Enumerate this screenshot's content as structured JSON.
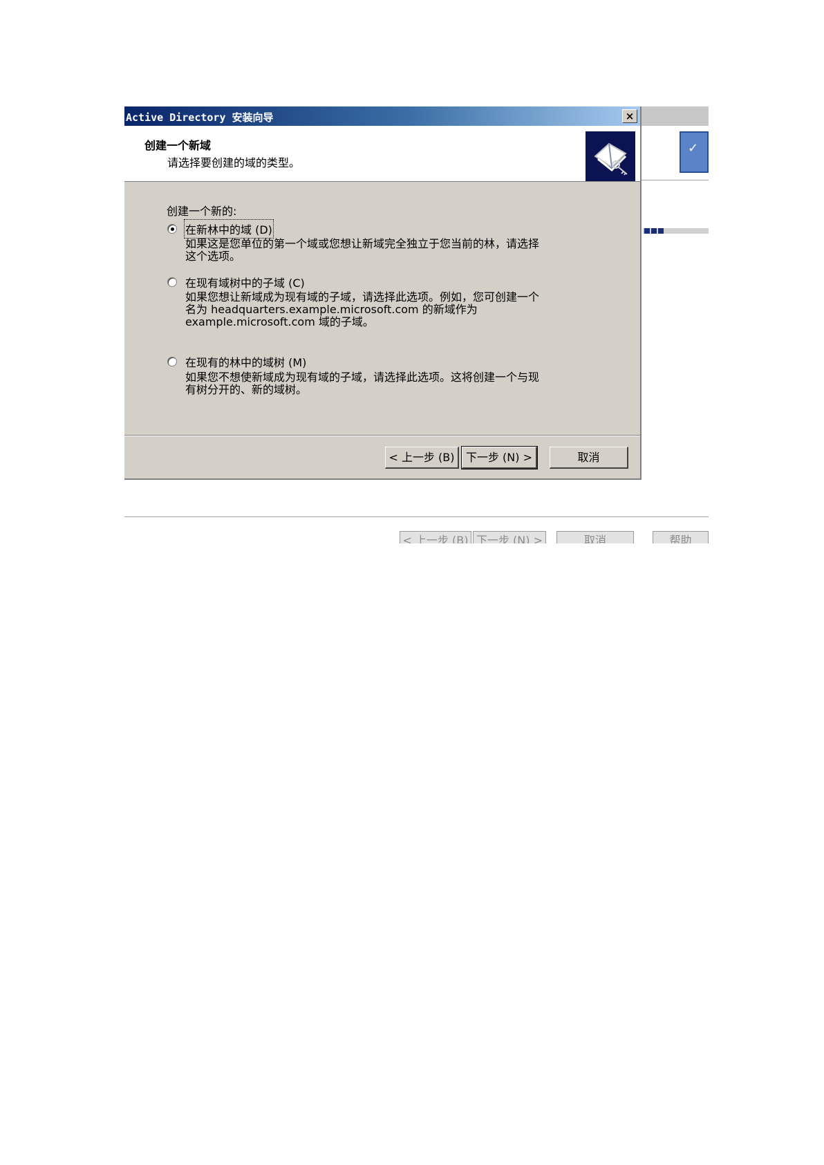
{
  "background_window": {
    "buttons": [
      "< 上一步 (B)",
      "下一步 (N) >",
      "取消",
      "帮助"
    ]
  },
  "dialog": {
    "title": "Active Directory 安装向导",
    "close_glyph": "×",
    "header": {
      "title": "创建一个新域",
      "subtitle": "请选择要创建的域的类型。",
      "icon": "book-key-icon"
    },
    "group_label": "创建一个新的:",
    "options": [
      {
        "label": "在新林中的域 (D)",
        "selected": true,
        "description": "如果这是您单位的第一个域或您想让新域完全独立于您当前的林，请选择\n这个选项。"
      },
      {
        "label": "在现有域树中的子域 (C)",
        "selected": false,
        "description": "如果您想让新域成为现有域的子域，请选择此选项。例如，您可创建一个\n名为 headquarters.example.microsoft.com 的新域作为\nexample.microsoft.com 域的子域。"
      },
      {
        "label": "在现有的林中的域树 (M)",
        "selected": false,
        "description": "如果您不想使新域成为现有域的子域，请选择此选项。这将创建一个与现\n有树分开的、新的域树。"
      }
    ],
    "buttons": {
      "back": "< 上一步 (B)",
      "next": "下一步 (N) >",
      "cancel": "取消"
    }
  }
}
